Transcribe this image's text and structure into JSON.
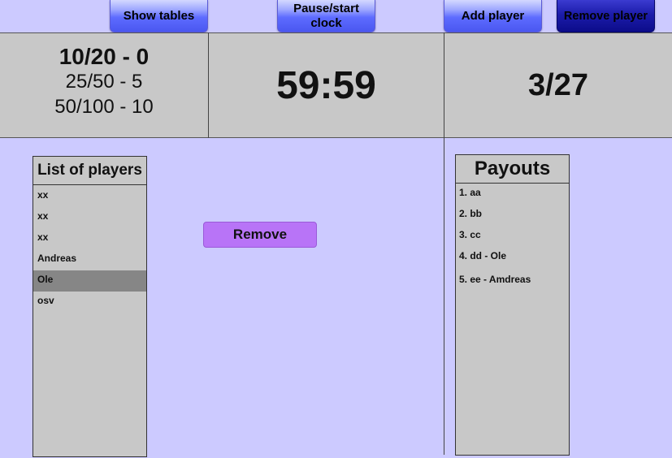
{
  "toolbar": {
    "show_tables": "Show tables",
    "pause_start_clock": "Pause/start clock",
    "add_player": "Add player",
    "remove_player": "Remove player"
  },
  "blinds": {
    "current": "10/20 - 0",
    "next": "25/50 - 5",
    "following": "50/100 - 10"
  },
  "clock": {
    "time": "59:59"
  },
  "players_count": "3/27",
  "players_list": {
    "title": "List of players",
    "items": [
      "xx",
      "xx",
      "xx",
      "Andreas",
      "Ole",
      "osv"
    ],
    "selected": "Ole"
  },
  "remove_button": "Remove",
  "payouts": {
    "title": "Payouts",
    "items": [
      "1. aa",
      "2. bb",
      "3. cc",
      "4. dd - Ole",
      "5. ee - Amdreas"
    ]
  },
  "colors": {
    "background": "#cccaff",
    "panel": "#c8c8c8",
    "button_blue": "#5d6bff",
    "button_dark_blue": "#0c0c8a",
    "remove_purple": "#b874f7",
    "selected_row": "#868686"
  }
}
